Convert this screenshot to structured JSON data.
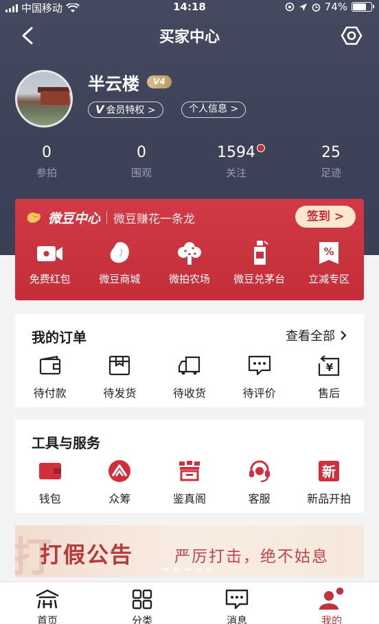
{
  "status_bar": {
    "carrier": "中国移动",
    "time": "14:18",
    "battery": "74%",
    "battery_level": 0.74
  },
  "nav": {
    "title": "买家中心"
  },
  "profile": {
    "name": "半云楼",
    "level_badge": "V4",
    "member_prefix": "V",
    "member_link": "会员特权 >",
    "profile_link": "个人信息 >"
  },
  "stats": [
    {
      "value": "0",
      "label": "参拍"
    },
    {
      "value": "0",
      "label": "围观"
    },
    {
      "value": "1594",
      "label": "关注"
    },
    {
      "value": "25",
      "label": "足迹"
    }
  ],
  "bean_center": {
    "logo": "微豆中心",
    "slogan": "微豆赚花一条龙",
    "signin": "签到 >",
    "items": [
      {
        "label": "免费红包",
        "icon": "video-icon"
      },
      {
        "label": "微豆商城",
        "icon": "bean-icon"
      },
      {
        "label": "微拍农场",
        "icon": "tree-icon"
      },
      {
        "label": "微豆兑茅台",
        "icon": "liquor-bottle-icon"
      },
      {
        "label": "立减专区",
        "icon": "discount-icon"
      }
    ]
  },
  "orders": {
    "title": "我的订单",
    "view_all": "查看全部",
    "items": [
      {
        "label": "待付款",
        "icon": "wallet-icon"
      },
      {
        "label": "待发货",
        "icon": "package-icon"
      },
      {
        "label": "待收货",
        "icon": "truck-icon"
      },
      {
        "label": "待评价",
        "icon": "comment-icon"
      },
      {
        "label": "售后",
        "icon": "refund-icon"
      }
    ]
  },
  "tools": {
    "title": "工具与服务",
    "items": [
      {
        "label": "钱包",
        "icon": "wallet-icon"
      },
      {
        "label": "众筹",
        "icon": "crowdfunding-icon"
      },
      {
        "label": "鉴真阁",
        "icon": "appraisal-icon"
      },
      {
        "label": "客服",
        "icon": "headset-icon"
      },
      {
        "label": "新品开拍",
        "icon": "new-icon"
      }
    ]
  },
  "banner": {
    "title": "打假公告",
    "subtitle": "严厉打击，绝不姑息",
    "ghost": "打"
  },
  "tabbar": [
    {
      "label": "首页",
      "icon": "home-icon"
    },
    {
      "label": "分类",
      "icon": "grid-icon"
    },
    {
      "label": "消息",
      "icon": "message-icon"
    },
    {
      "label": "我的",
      "icon": "user-icon"
    }
  ],
  "colors": {
    "accent": "#c4303b",
    "header": "#41455b",
    "gold": "#d9c08e"
  }
}
